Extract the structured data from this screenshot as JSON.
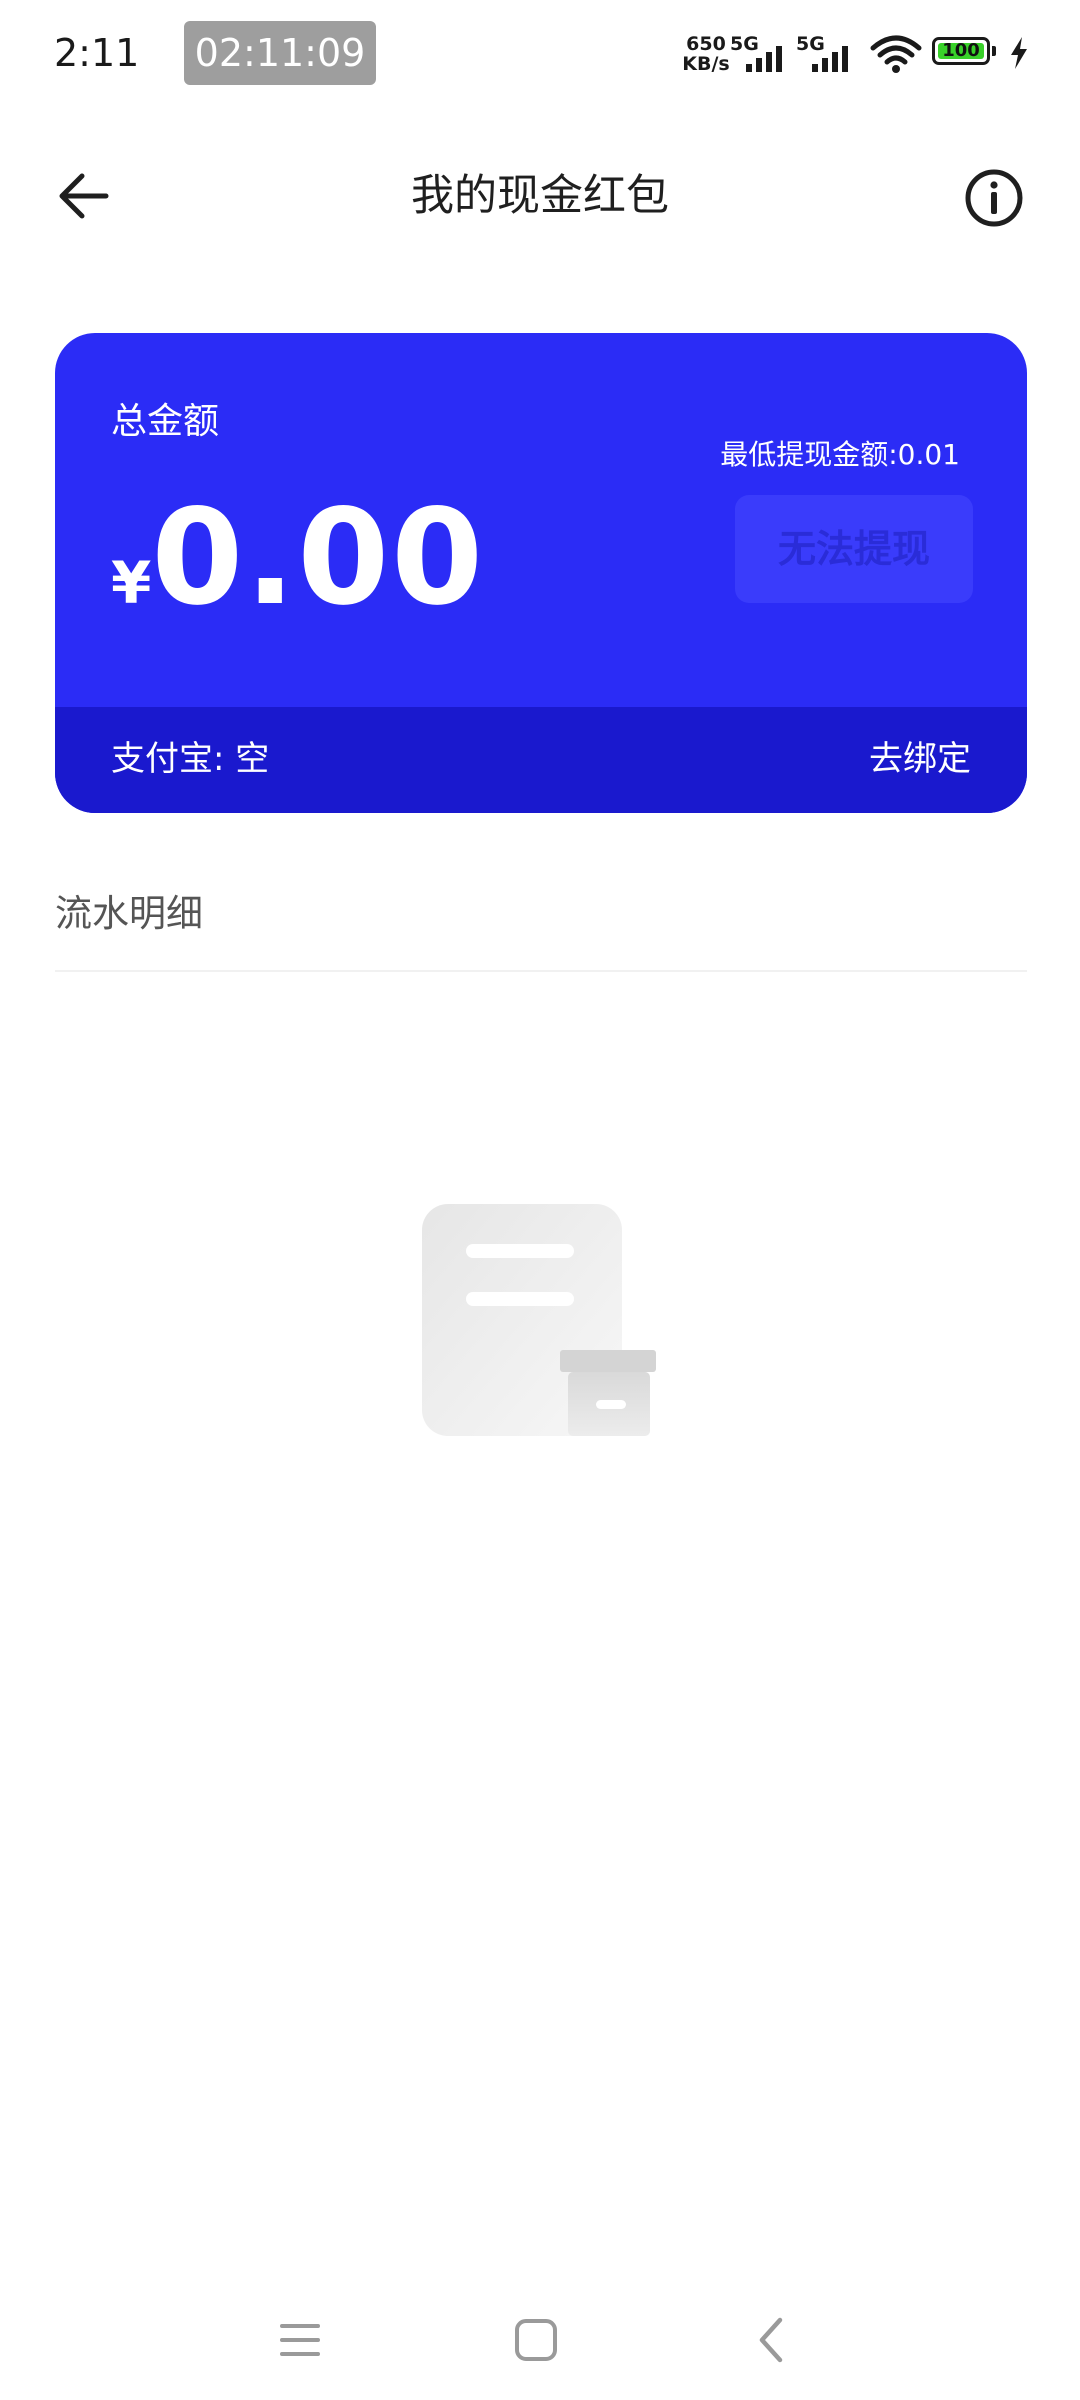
{
  "status_bar": {
    "time": "2:11",
    "recording_timer": "02:11:09",
    "net_speed_value": "650",
    "net_speed_unit": "KB/s",
    "sim1_type": "5G",
    "sim2_type": "5G",
    "battery_level": "100",
    "battery_color": "#39d12a"
  },
  "header": {
    "title": "我的现金红包",
    "back_icon": "arrow-left-icon",
    "info_icon": "info-circle-icon"
  },
  "card": {
    "accent_color": "#2b2cf6",
    "footer_color": "#1a19ce",
    "total_label": "总金额",
    "currency_symbol": "¥",
    "amount": "0.00",
    "min_withdraw_text": "最低提现金额:0.01",
    "withdraw_button_label": "无法提现",
    "alipay_label": "支付宝: 空",
    "unbind_label": "去绑定"
  },
  "transactions": {
    "section_title": "流水明细",
    "empty_icon": "empty-document-box-icon"
  },
  "nav_bar": {
    "menu_icon": "menu-icon",
    "home_icon": "home-square-icon",
    "back_icon": "chevron-left-icon"
  }
}
